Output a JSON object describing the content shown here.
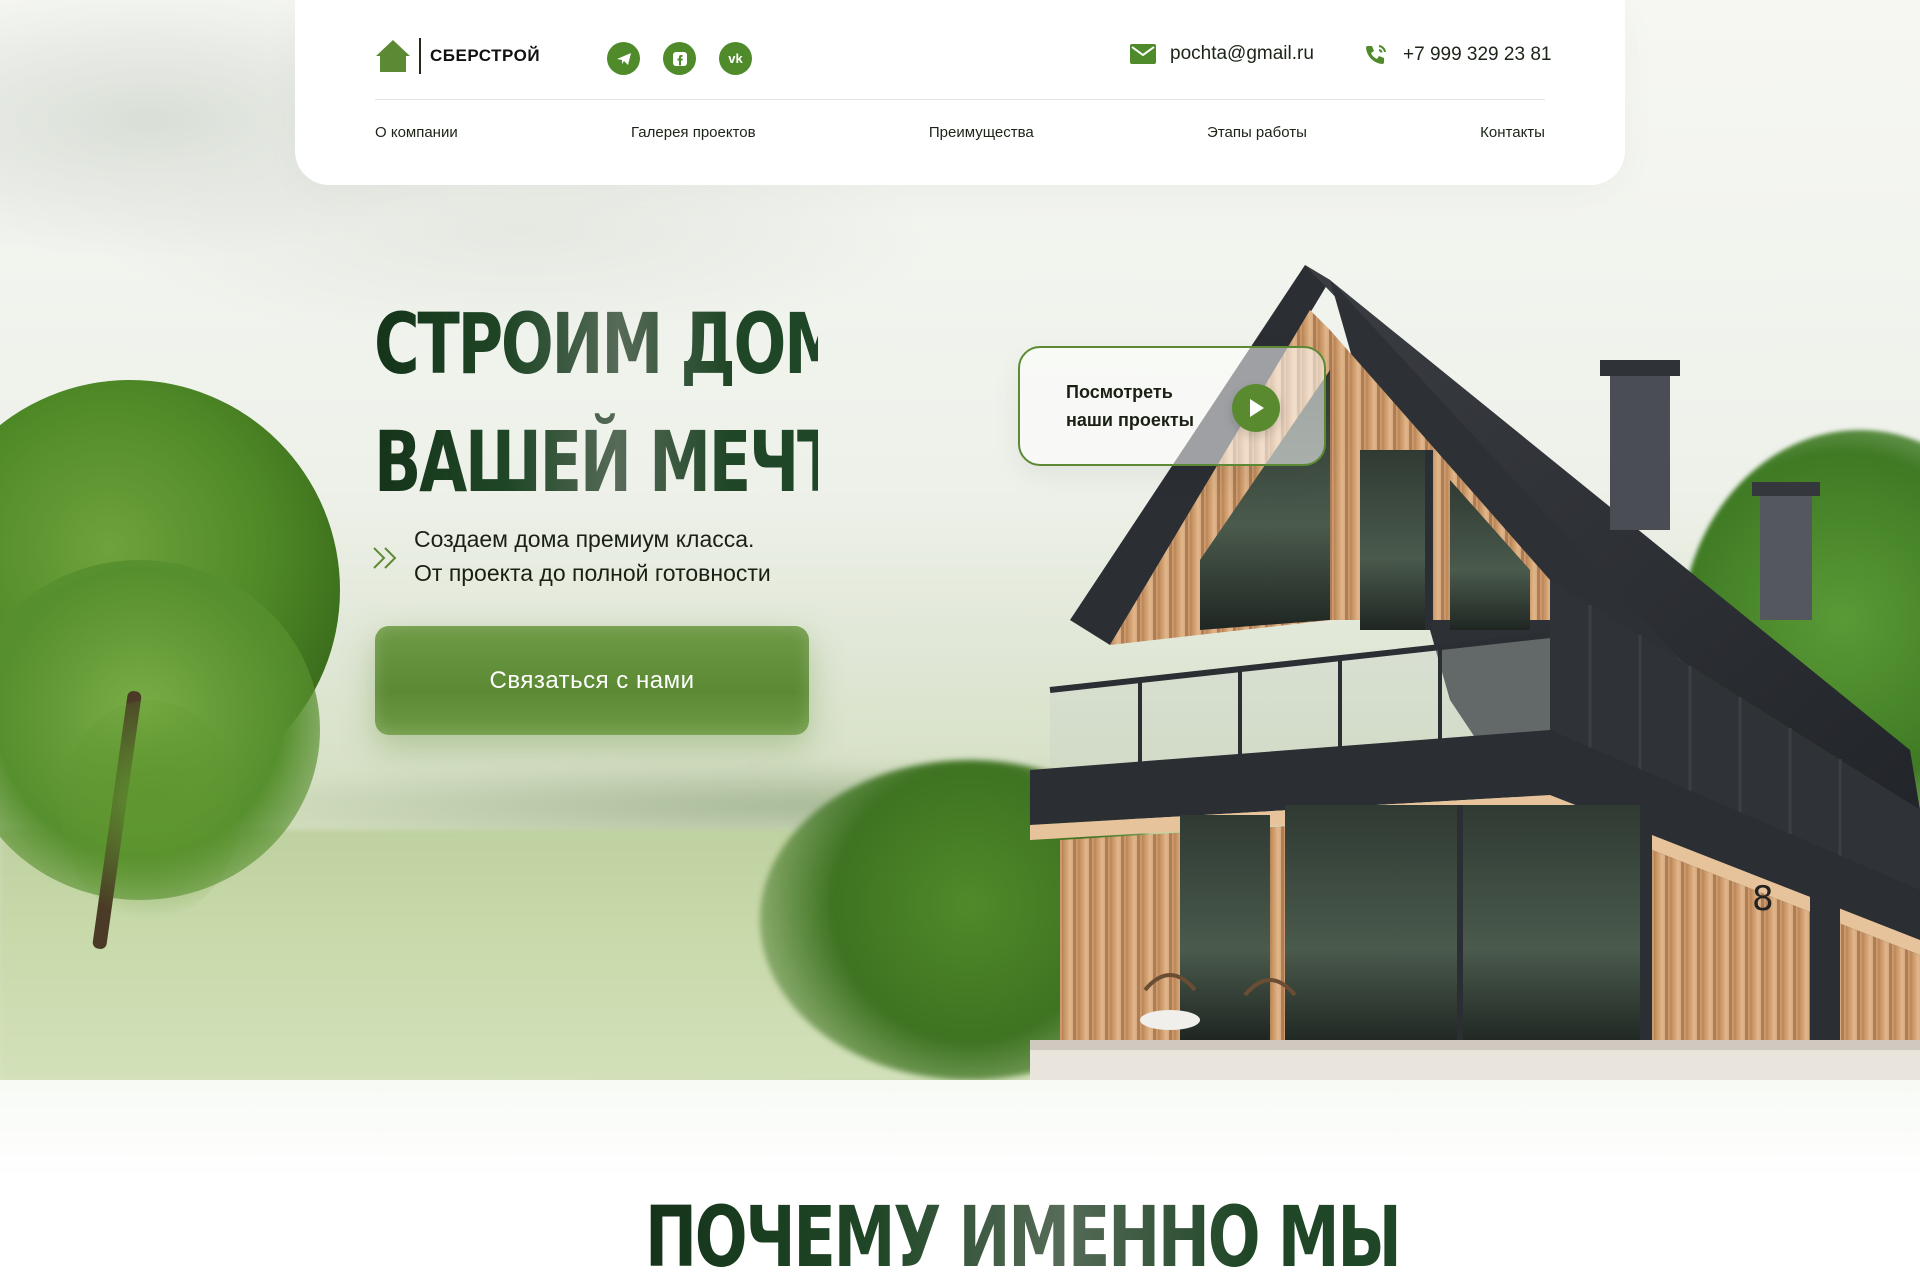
{
  "brand": {
    "name": "СБЕРСТРОЙ",
    "accent": "#5c8a34",
    "dark": "#1f4626"
  },
  "socials": [
    {
      "icon": "telegram-icon"
    },
    {
      "icon": "facebook-icon"
    },
    {
      "icon": "vk-icon",
      "text": "vk"
    }
  ],
  "contacts": {
    "email": "pochta@gmail.ru",
    "phone": "+7 999 329 23 81"
  },
  "nav": {
    "items": [
      {
        "label": "О компании"
      },
      {
        "label": "Галерея проектов"
      },
      {
        "label": "Преимущества"
      },
      {
        "label": "Этапы работы"
      },
      {
        "label": "Контакты"
      }
    ]
  },
  "hero": {
    "title_line1": "Строим дома",
    "title_line2": "вашей мечты",
    "subtitle_line1": "Создаем дома премиум класса.",
    "subtitle_line2": "От проекта до полной готовности",
    "cta_label": "Связаться с нами",
    "projects_label_line1": "Посмотреть",
    "projects_label_line2": "наши проекты",
    "house_number": "8"
  },
  "why": {
    "title": "Почему именно мы"
  }
}
